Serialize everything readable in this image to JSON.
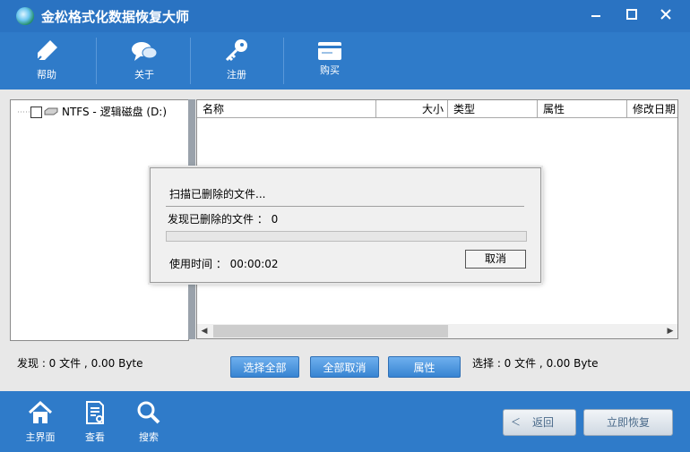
{
  "window": {
    "title": "金松格式化数据恢复大师",
    "minimize_icon": "minimize-icon",
    "maximize_icon": "maximize-icon",
    "close_icon": "close-icon"
  },
  "toolbar": {
    "items": [
      {
        "label": "帮助",
        "icon": "pen-help-icon"
      },
      {
        "label": "关于",
        "icon": "chat-bubbles-icon"
      },
      {
        "label": "注册",
        "icon": "key-icon"
      },
      {
        "label": "购买",
        "icon": "card-icon"
      }
    ]
  },
  "tree": {
    "drive_label": "NTFS - 逻辑磁盘 (D:)"
  },
  "file_list": {
    "columns": [
      "名称",
      "大小",
      "类型",
      "属性",
      "修改日期"
    ]
  },
  "dialog": {
    "scanning_text": "扫描已删除的文件...",
    "found_text": "发现已删除的文件 ： 0",
    "found_count": 0,
    "progress": 0,
    "elapsed_text": "使用时间 ： 00:00:02",
    "cancel_label": "取消"
  },
  "status": {
    "found": "发现 : 0 文件 , 0.00 Byte",
    "selected": "选择 : 0 文件 , 0.00 Byte"
  },
  "actions": {
    "select_all": "选择全部",
    "deselect_all": "全部取消",
    "properties": "属性"
  },
  "footer": {
    "nav": [
      {
        "label": "主界面",
        "icon": "home-icon"
      },
      {
        "label": "查看",
        "icon": "document-icon"
      },
      {
        "label": "搜索",
        "icon": "search-icon"
      }
    ],
    "back_label": "返回",
    "recover_label": "立即恢复"
  },
  "colors": {
    "title_bar": "#2a73c2",
    "toolbar": "#2f7bc9",
    "action_button": "#3784d2"
  }
}
